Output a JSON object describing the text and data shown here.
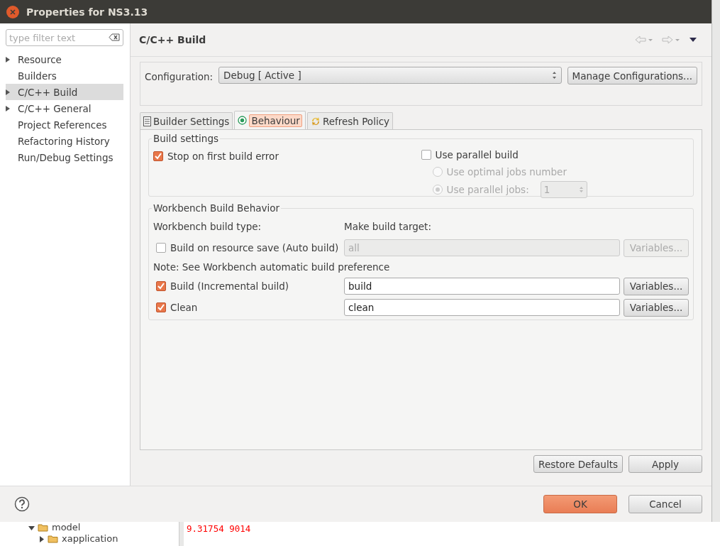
{
  "window": {
    "title": "Properties for NS3.13"
  },
  "sidebar": {
    "filter": {
      "placeholder": "type filter text"
    },
    "items": [
      {
        "label": "Resource",
        "expandable": true,
        "selected": false
      },
      {
        "label": "Builders",
        "expandable": false,
        "selected": false
      },
      {
        "label": "C/C++ Build",
        "expandable": true,
        "selected": true
      },
      {
        "label": "C/C++ General",
        "expandable": true,
        "selected": false
      },
      {
        "label": "Project References",
        "expandable": false,
        "selected": false
      },
      {
        "label": "Refactoring History",
        "expandable": false,
        "selected": false
      },
      {
        "label": "Run/Debug Settings",
        "expandable": false,
        "selected": false
      }
    ]
  },
  "page": {
    "title": "C/C++ Build"
  },
  "configuration": {
    "label": "Configuration:",
    "value": "Debug  [ Active ]",
    "button": "Manage Configurations..."
  },
  "tabs": [
    {
      "label": "Builder Settings",
      "selected": false
    },
    {
      "label": "Behaviour",
      "selected": true
    },
    {
      "label": "Refresh Policy",
      "selected": false
    }
  ],
  "build_settings": {
    "title": "Build settings",
    "stop_on_error": {
      "label": "Stop on first build error",
      "checked": true
    },
    "parallel": {
      "label": "Use parallel build",
      "checked": false
    },
    "job_options": [
      {
        "label": "Use optimal jobs number",
        "selected": false,
        "disabled": true
      },
      {
        "label": "Use parallel jobs:",
        "selected": true,
        "disabled": true
      }
    ],
    "jobs": {
      "value": "1",
      "disabled": true
    }
  },
  "workbench": {
    "title": "Workbench Build Behavior",
    "type_label": "Workbench build type:",
    "target_label": "Make build target:",
    "rows": [
      {
        "kind": "option",
        "label": "Build on resource save (Auto build)",
        "checked": false,
        "value": "all",
        "disabled": true,
        "button": "Variables..."
      },
      {
        "kind": "note",
        "label": "Note: See Workbench automatic build preference"
      },
      {
        "kind": "option",
        "label": "Build (Incremental build)",
        "checked": true,
        "value": "build",
        "disabled": false,
        "button": "Variables..."
      },
      {
        "kind": "option",
        "label": "Clean",
        "checked": true,
        "value": "clean",
        "disabled": false,
        "button": "Variables..."
      }
    ]
  },
  "page_buttons": [
    "Restore Defaults",
    "Apply"
  ],
  "buttons": [
    {
      "label": "OK",
      "default": true
    },
    {
      "label": "Cancel",
      "default": false
    }
  ],
  "background": {
    "tree": [
      {
        "label": "model",
        "expanded": true,
        "children": [
          {
            "label": "xapplication",
            "expanded": false
          }
        ]
      }
    ],
    "console_line": "9.31754 9014"
  }
}
